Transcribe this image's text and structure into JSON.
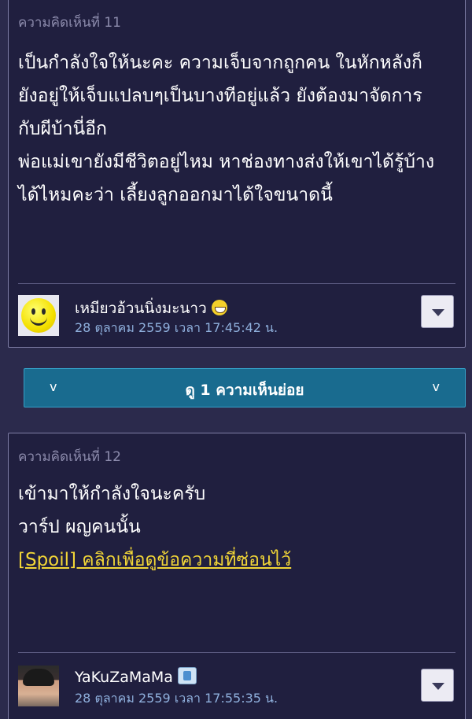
{
  "comments": [
    {
      "label": "ความคิดเห็นที่ 11",
      "paragraphs": [
        "เป็นกำลังใจให้นะคะ ความเจ็บจากถูกคน ในหักหลังก็\nยังอยู่ให้เจ็บแปลบๆเป็นบางทีอยู่แล้ว ยังต้องมาจัดการ\nกับผีบ้านี่อีก",
        "พ่อแม่เขายังมีชีวิตอยู่ไหม หาช่องทางส่งให้เขาได้รู้บ้าง\nได้ไหมคะว่า เลี้ยงลูกออกมาได้ใจขนาดนี้"
      ],
      "author": "เหมียวอ้วนนิ่งมะนาว",
      "author_avatar": "smiley-face-avatar",
      "author_badge_icon": "grinning-emoji-icon",
      "timestamp": "28 ตุลาคม 2559 เวลา 17:45:42 น."
    },
    {
      "label": "ความคิดเห็นที่ 12",
      "paragraphs": [
        "เข้ามาให้กำลังใจนะครับ",
        "วาร์ป ผญคนนั้น"
      ],
      "spoiler_link": "[Spoil] คลิกเพื่อดูข้อความที่ซ่อนไว้",
      "author": "YaKuZaMaMa",
      "author_avatar": "user-photo-avatar",
      "author_badge_icon": "blog-badge-icon",
      "timestamp": "28 ตุลาคม 2559 เวลา 17:55:35 น."
    }
  ],
  "expand_replies": {
    "label": "ดู 1 ความเห็นย่อย",
    "chevron": "v"
  },
  "colors": {
    "background": "#2b2a4c",
    "card": "#201f3f",
    "expand_bar": "#196b8f",
    "spoiler_link": "#f2d637",
    "timestamp": "#8fb0dd"
  }
}
